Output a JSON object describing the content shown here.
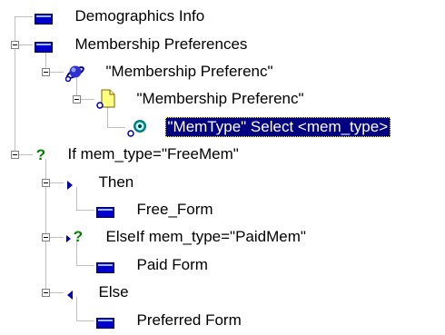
{
  "tree": {
    "colors": {
      "selection_bg": "#000080",
      "selection_fg": "#ffffff",
      "connector": "#808080",
      "form_icon": "#0000cc",
      "question_icon": "#008000"
    },
    "nodes": [
      {
        "label": "Demographics Info",
        "icon": "form-icon",
        "depth": 0,
        "expander": "none",
        "selected": false
      },
      {
        "label": "Membership Preferences",
        "icon": "form-icon",
        "depth": 0,
        "expander": "expanded",
        "selected": false
      },
      {
        "label": "\"Membership Preferenc\"",
        "icon": "globe-icon",
        "depth": 1,
        "expander": "expanded",
        "selected": false
      },
      {
        "label": "\"Membership Preferenc\"",
        "icon": "document-icon",
        "depth": 2,
        "expander": "expanded",
        "selected": false
      },
      {
        "label": "\"MemType\" Select <mem_type>",
        "icon": "select-field-icon",
        "depth": 3,
        "expander": "none",
        "selected": true
      },
      {
        "label": "If mem_type=\"FreeMem\"",
        "icon": "question-icon",
        "depth": 0,
        "expander": "expanded",
        "selected": false
      },
      {
        "label": "Then",
        "icon": "right-arrow-icon",
        "depth": 1,
        "expander": "expanded",
        "selected": false
      },
      {
        "label": "Free_Form",
        "icon": "form-icon",
        "depth": 2,
        "expander": "none",
        "selected": false
      },
      {
        "label": "ElseIf mem_type=\"PaidMem\"",
        "icon": "arrow-question-icon",
        "depth": 1,
        "expander": "expanded",
        "selected": false
      },
      {
        "label": "Paid Form",
        "icon": "form-icon",
        "depth": 2,
        "expander": "none",
        "selected": false
      },
      {
        "label": "Else",
        "icon": "left-arrow-icon",
        "depth": 1,
        "expander": "expanded",
        "selected": false
      },
      {
        "label": "Preferred Form",
        "icon": "form-icon",
        "depth": 2,
        "expander": "none",
        "selected": false
      }
    ]
  }
}
